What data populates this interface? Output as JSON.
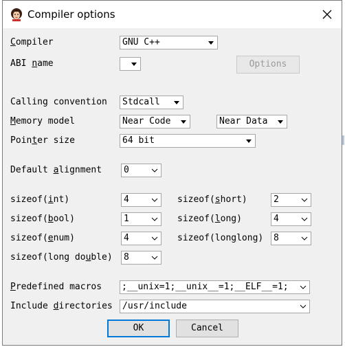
{
  "window": {
    "title": "Compiler options",
    "close_glyph": "✕"
  },
  "labels": {
    "compiler": "Compiler",
    "abi_name": "ABI name",
    "calling_convention": "Calling convention",
    "memory_model": "Memory model",
    "pointer_size": "Pointer size",
    "default_alignment": "Default alignment",
    "sizeof_int": "sizeof(int)",
    "sizeof_short": "sizeof(short)",
    "sizeof_bool": "sizeof(bool)",
    "sizeof_long": "sizeof(long)",
    "sizeof_enum": "sizeof(enum)",
    "sizeof_longlong": "sizeof(longlong)",
    "sizeof_long_double": "sizeof(long double)",
    "predefined_macros": "Predefined macros",
    "include_directories": "Include directories"
  },
  "values": {
    "compiler": "GNU C++",
    "abi_name": "",
    "calling_convention": "Stdcall",
    "memory_model_code": "Near Code",
    "memory_model_data": "Near Data",
    "pointer_size": "64 bit",
    "default_alignment": "0",
    "sizeof_int": "4",
    "sizeof_short": "2",
    "sizeof_bool": "1",
    "sizeof_long": "4",
    "sizeof_enum": "4",
    "sizeof_longlong": "8",
    "sizeof_long_double": "8",
    "predefined_macros": ";__unix=1;__unix__=1;__ELF__=1;",
    "include_directories": "/usr/include"
  },
  "buttons": {
    "options": "Options",
    "ok": "OK",
    "cancel": "Cancel"
  },
  "icons": {
    "app": "ida-avatar-icon",
    "close": "close-icon",
    "dropdown": "dropdown-arrow-icon",
    "chevron": "chevron-down-icon"
  }
}
